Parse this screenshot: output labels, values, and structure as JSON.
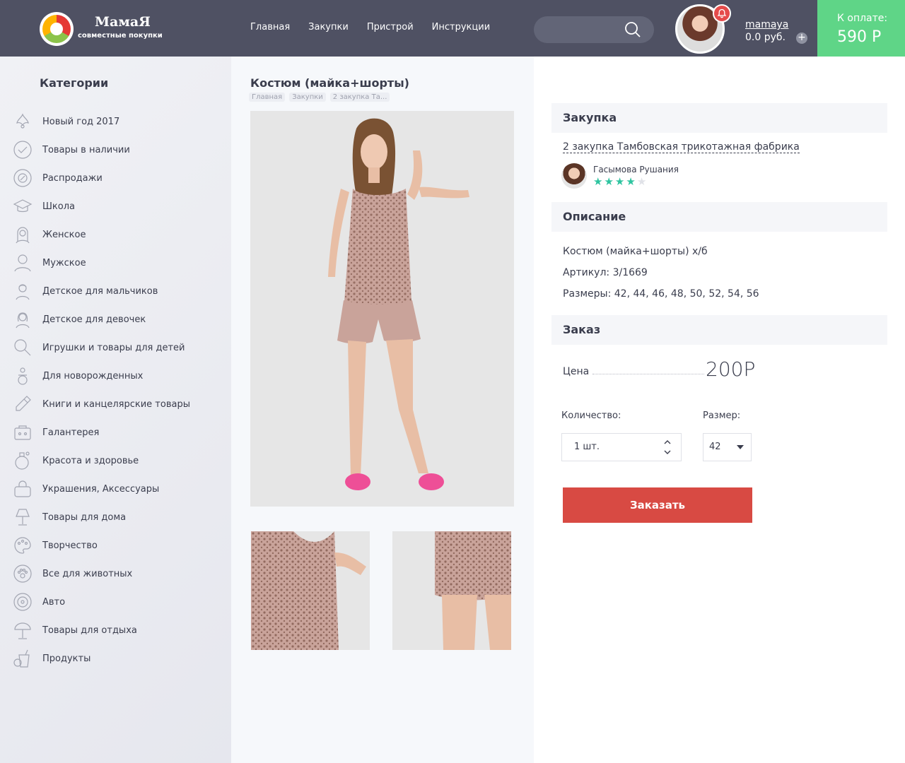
{
  "colors": {
    "header": "#4f5163",
    "pay_bg": "#5fd587",
    "order_button": "#d84a43",
    "rating_star": "#2ec4a0"
  },
  "header": {
    "logo_title": "МамаЯ",
    "logo_subtitle": "совместные покупки",
    "nav": [
      "Главная",
      "Закупки",
      "Пристрой",
      "Инструкции"
    ],
    "search_icon": "search-icon",
    "username": "mamaya",
    "balance": "0.0 руб.",
    "pay_label": "К оплате:",
    "pay_amount": "590 Р"
  },
  "sidebar": {
    "title": "Категории",
    "items": [
      {
        "label": "Новый год 2017",
        "icon": "christmas-icon"
      },
      {
        "label": "Товары в наличии",
        "icon": "checkmark-icon"
      },
      {
        "label": "Распродажи",
        "icon": "sale-icon"
      },
      {
        "label": "Школа",
        "icon": "graduation-cap-icon"
      },
      {
        "label": "Женское",
        "icon": "woman-icon"
      },
      {
        "label": "Мужское",
        "icon": "man-icon"
      },
      {
        "label": "Детское для мальчиков",
        "icon": "boy-icon"
      },
      {
        "label": "Детское для девочек",
        "icon": "girl-icon"
      },
      {
        "label": "Игрушки и товары для детей",
        "icon": "rattle-icon"
      },
      {
        "label": "Для новорожденных",
        "icon": "pacifier-icon"
      },
      {
        "label": "Книги и канцелярские товары",
        "icon": "pen-icon"
      },
      {
        "label": "Галантерея",
        "icon": "haberdashery-icon"
      },
      {
        "label": "Красота и здоровье",
        "icon": "perfume-icon"
      },
      {
        "label": "Украшения, Аксессуары",
        "icon": "handbag-icon"
      },
      {
        "label": "Товары для дома",
        "icon": "lamp-icon"
      },
      {
        "label": "Творчество",
        "icon": "palette-icon"
      },
      {
        "label": "Все для животных",
        "icon": "paw-icon"
      },
      {
        "label": "Авто",
        "icon": "wheel-icon"
      },
      {
        "label": "Товары для отдыха",
        "icon": "umbrella-icon"
      },
      {
        "label": "Продукты",
        "icon": "drink-icon"
      }
    ]
  },
  "product": {
    "title": "Костюм (майка+шорты)",
    "breadcrumb": [
      "Главная",
      "Закупки",
      "2 закупка Та..."
    ]
  },
  "details": {
    "purchase_heading": "Закупка",
    "purchase_link": "2 закупка Тамбовская трикотажная фабрика",
    "organizer_name": "Гасымова Рушания",
    "organizer_rating": 4,
    "organizer_rating_max": 5,
    "description_heading": "Описание",
    "description_lines": [
      "Костюм (майка+шорты) х/б",
      "Артикул: 3/1669",
      "Размеры: 42, 44, 46, 48, 50, 52, 54, 56"
    ],
    "order_heading": "Заказ",
    "price_label": "Цена",
    "price_value": "200Р",
    "quantity_label": "Количество:",
    "quantity_value": "1 шт.",
    "size_label": "Размер:",
    "size_value": "42",
    "order_button": "Заказать"
  }
}
